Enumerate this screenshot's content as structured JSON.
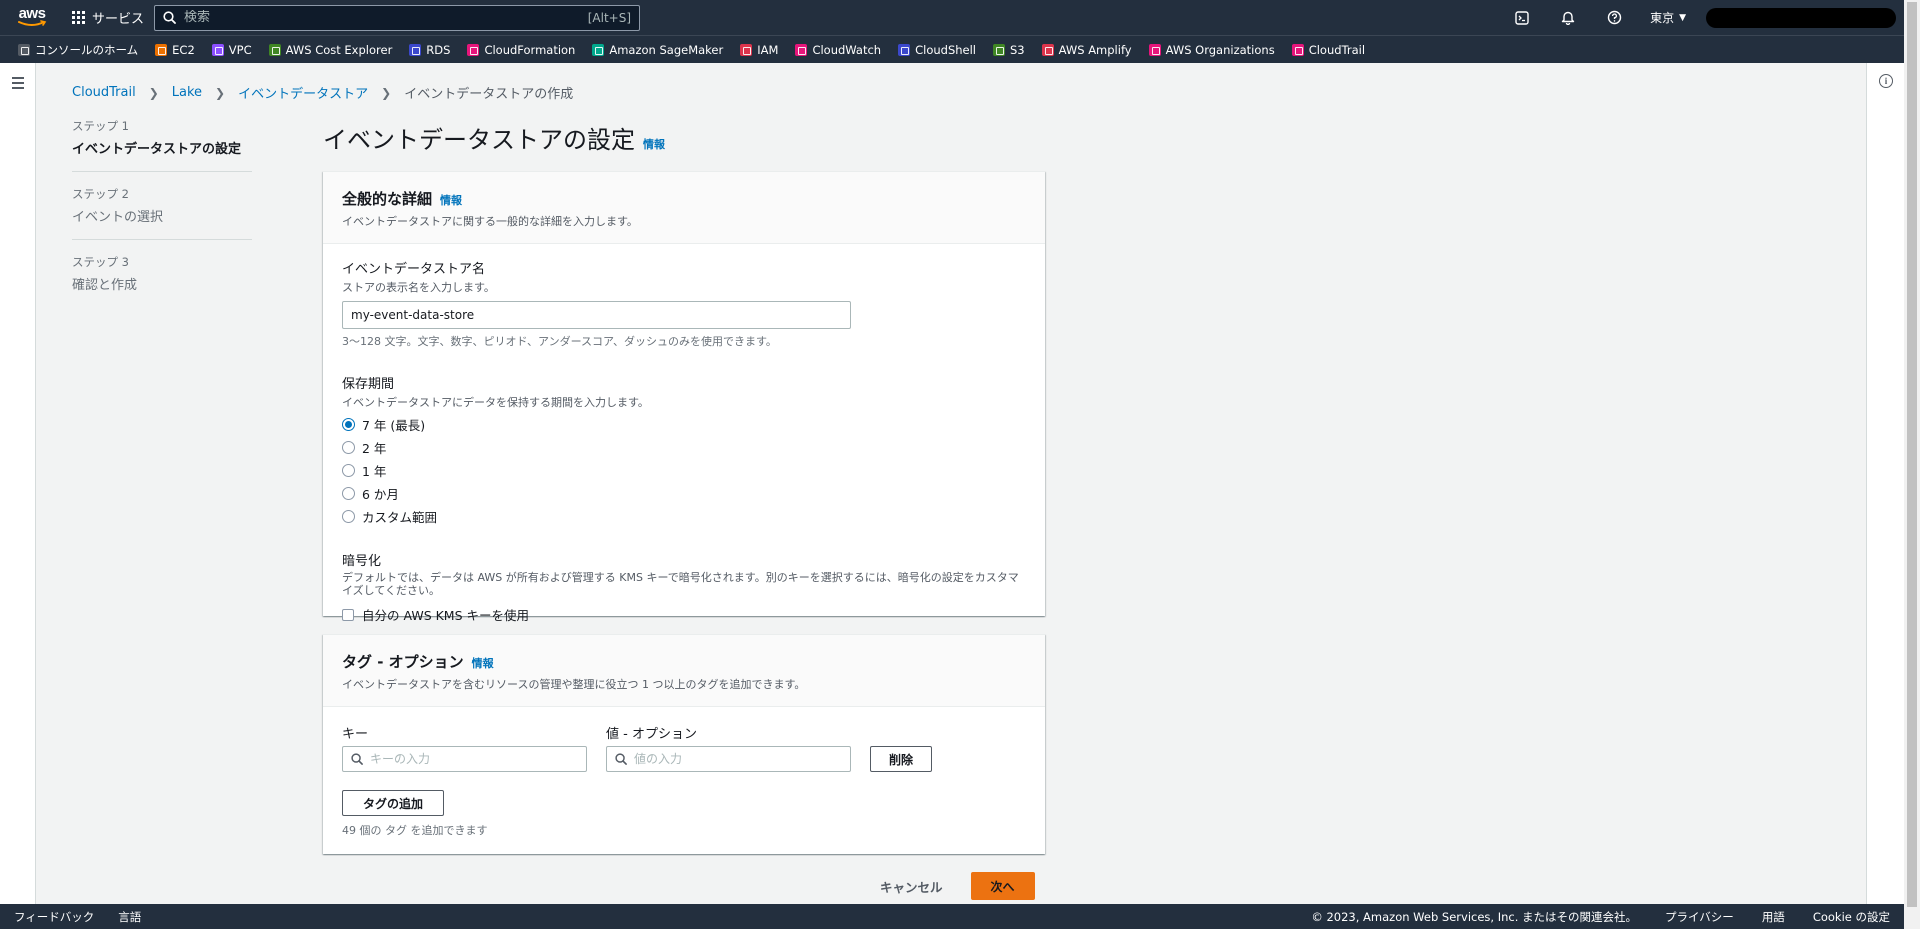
{
  "topnav": {
    "logo_text": "aws",
    "services_label": "サービス",
    "search_placeholder": "検索",
    "search_shortcut": "[Alt+S]",
    "region": "東京"
  },
  "favorites": [
    {
      "label": "コンソールのホーム",
      "color": "#545b64"
    },
    {
      "label": "EC2",
      "color": "#ed7100"
    },
    {
      "label": "VPC",
      "color": "#8c4fff"
    },
    {
      "label": "AWS Cost Explorer",
      "color": "#3f8624"
    },
    {
      "label": "RDS",
      "color": "#3b48cc"
    },
    {
      "label": "CloudFormation",
      "color": "#e7157b"
    },
    {
      "label": "Amazon SageMaker",
      "color": "#01a88d"
    },
    {
      "label": "IAM",
      "color": "#dd344c"
    },
    {
      "label": "CloudWatch",
      "color": "#e7157b"
    },
    {
      "label": "CloudShell",
      "color": "#3b48cc"
    },
    {
      "label": "S3",
      "color": "#3f8624"
    },
    {
      "label": "AWS Amplify",
      "color": "#dd344c"
    },
    {
      "label": "AWS Organizations",
      "color": "#e7157b"
    },
    {
      "label": "CloudTrail",
      "color": "#e7157b"
    }
  ],
  "breadcrumb": {
    "items": [
      "CloudTrail",
      "Lake",
      "イベントデータストア"
    ],
    "current": "イベントデータストアの作成"
  },
  "steps": [
    {
      "num": "ステップ 1",
      "name": "イベントデータストアの設定"
    },
    {
      "num": "ステップ 2",
      "name": "イベントの選択"
    },
    {
      "num": "ステップ 3",
      "name": "確認と作成"
    }
  ],
  "page": {
    "title": "イベントデータストアの設定",
    "info": "情報"
  },
  "general": {
    "title": "全般的な詳細",
    "info": "情報",
    "desc": "イベントデータストアに関する一般的な詳細を入力します。",
    "name_label": "イベントデータストア名",
    "name_desc": "ストアの表示名を入力します。",
    "name_value": "my-event-data-store",
    "name_hint": "3～128 文字。文字、数字、ピリオド、アンダースコア、ダッシュのみを使用できます。",
    "retention_label": "保存期間",
    "retention_desc": "イベントデータストアにデータを保持する期間を入力します。",
    "retention_options": [
      "7 年 (最長)",
      "2 年",
      "1 年",
      "6 か月",
      "カスタム範囲"
    ],
    "encryption_label": "暗号化",
    "encryption_desc": "デフォルトでは、データは AWS が所有および管理する KMS キーで暗号化されます。別のキーを選択するには、暗号化の設定をカスタマイズしてください。",
    "kms_checkbox": "自分の AWS KMS キーを使用"
  },
  "tags": {
    "title": "タグ - オプション",
    "info": "情報",
    "desc": "イベントデータストアを含むリソースの管理や整理に役立つ 1 つ以上のタグを追加できます。",
    "key_label": "キー",
    "key_placeholder": "キーの入力",
    "value_label": "値 - オプション",
    "value_placeholder": "値の入力",
    "remove_label": "削除",
    "add_label": "タグの追加",
    "hint": "49 個の タグ を追加できます"
  },
  "actions": {
    "cancel": "キャンセル",
    "next": "次へ"
  },
  "footer": {
    "feedback": "フィードバック",
    "language": "言語",
    "copyright": "© 2023, Amazon Web Services, Inc. またはその関連会社。",
    "privacy": "プライバシー",
    "terms": "用語",
    "cookie": "Cookie の設定"
  }
}
